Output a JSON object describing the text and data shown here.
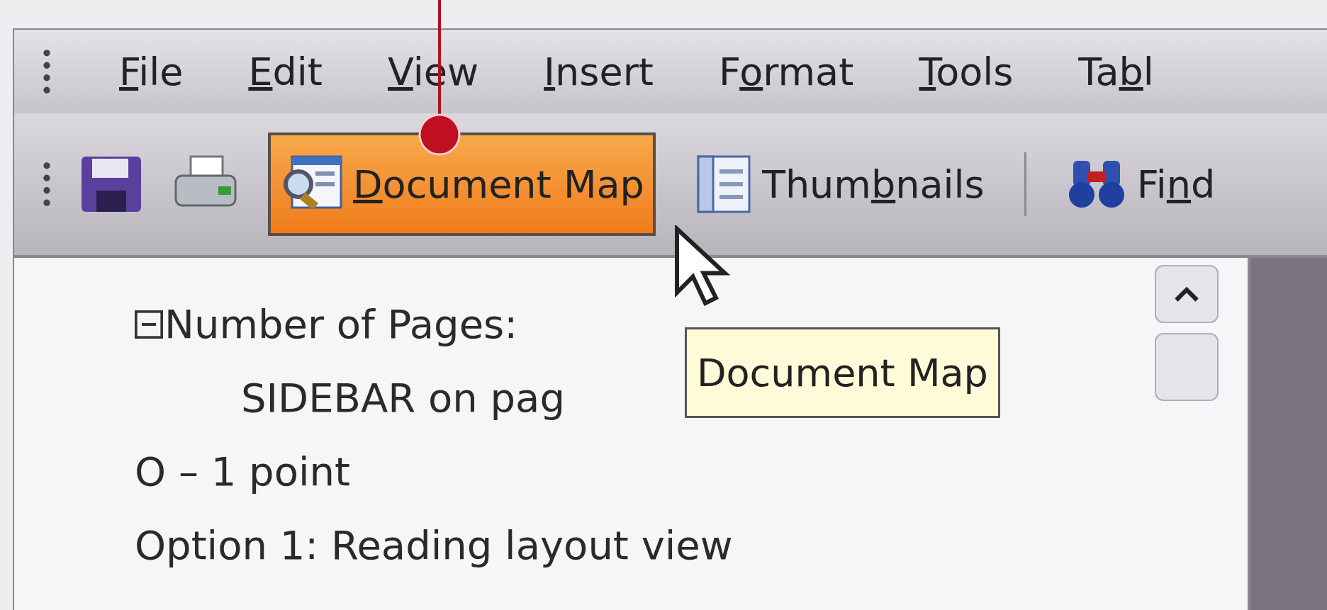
{
  "menu_bar": {
    "items": [
      {
        "key": "F",
        "post": "ile"
      },
      {
        "key": "E",
        "post": "dit"
      },
      {
        "key": "V",
        "post": "iew"
      },
      {
        "key": "I",
        "post": "nsert"
      },
      {
        "pre": "F",
        "key": "o",
        "post": "rmat"
      },
      {
        "key": "T",
        "post": "ools"
      },
      {
        "pre": "Ta",
        "key": "b",
        "post": "l"
      }
    ]
  },
  "toolbar": {
    "items": [
      {
        "kind": "icon"
      },
      {
        "kind": "icon"
      },
      {
        "kind": "button",
        "key": "D",
        "post": "ocument Map",
        "highlighted": true
      },
      {
        "kind": "button",
        "pre": "Thum",
        "key": "b",
        "post": "nails",
        "highlighted": false
      },
      {
        "kind": "separator"
      },
      {
        "kind": "button",
        "pre": "Fi",
        "key": "n",
        "post": "d",
        "highlighted": false
      }
    ]
  },
  "document_map": {
    "items": [
      {
        "label": "Number of Pages:",
        "expanded": true,
        "children": [
          {
            "label": "SIDEBAR on pag"
          }
        ]
      },
      {
        "label": "O – 1 point"
      },
      {
        "label": "Option 1: Reading layout view"
      }
    ]
  },
  "tooltip": {
    "text": "Document Map"
  }
}
